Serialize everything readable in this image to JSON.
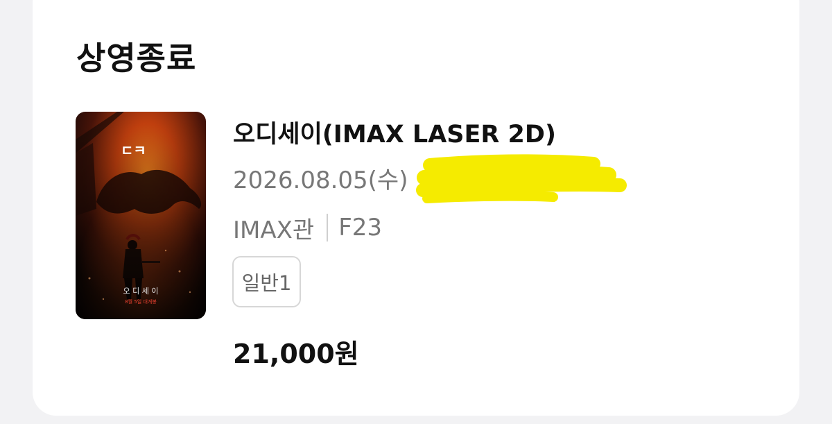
{
  "section": {
    "title": "상영종료"
  },
  "booking": {
    "poster": {
      "image_name": "odyssey-poster",
      "corner_mark": "ㄷㅋ",
      "poster_title": "오 디 세 이",
      "poster_subtitle": "8월 5일 대개봉"
    },
    "movie_title": "오디세이(IMAX LASER 2D)",
    "datetime": "2026.08.05(수)",
    "redaction_color": "#f5eb00",
    "venue": "IMAX관",
    "seat": "F23",
    "ticket_type": "일반1",
    "price": "21,000원"
  }
}
